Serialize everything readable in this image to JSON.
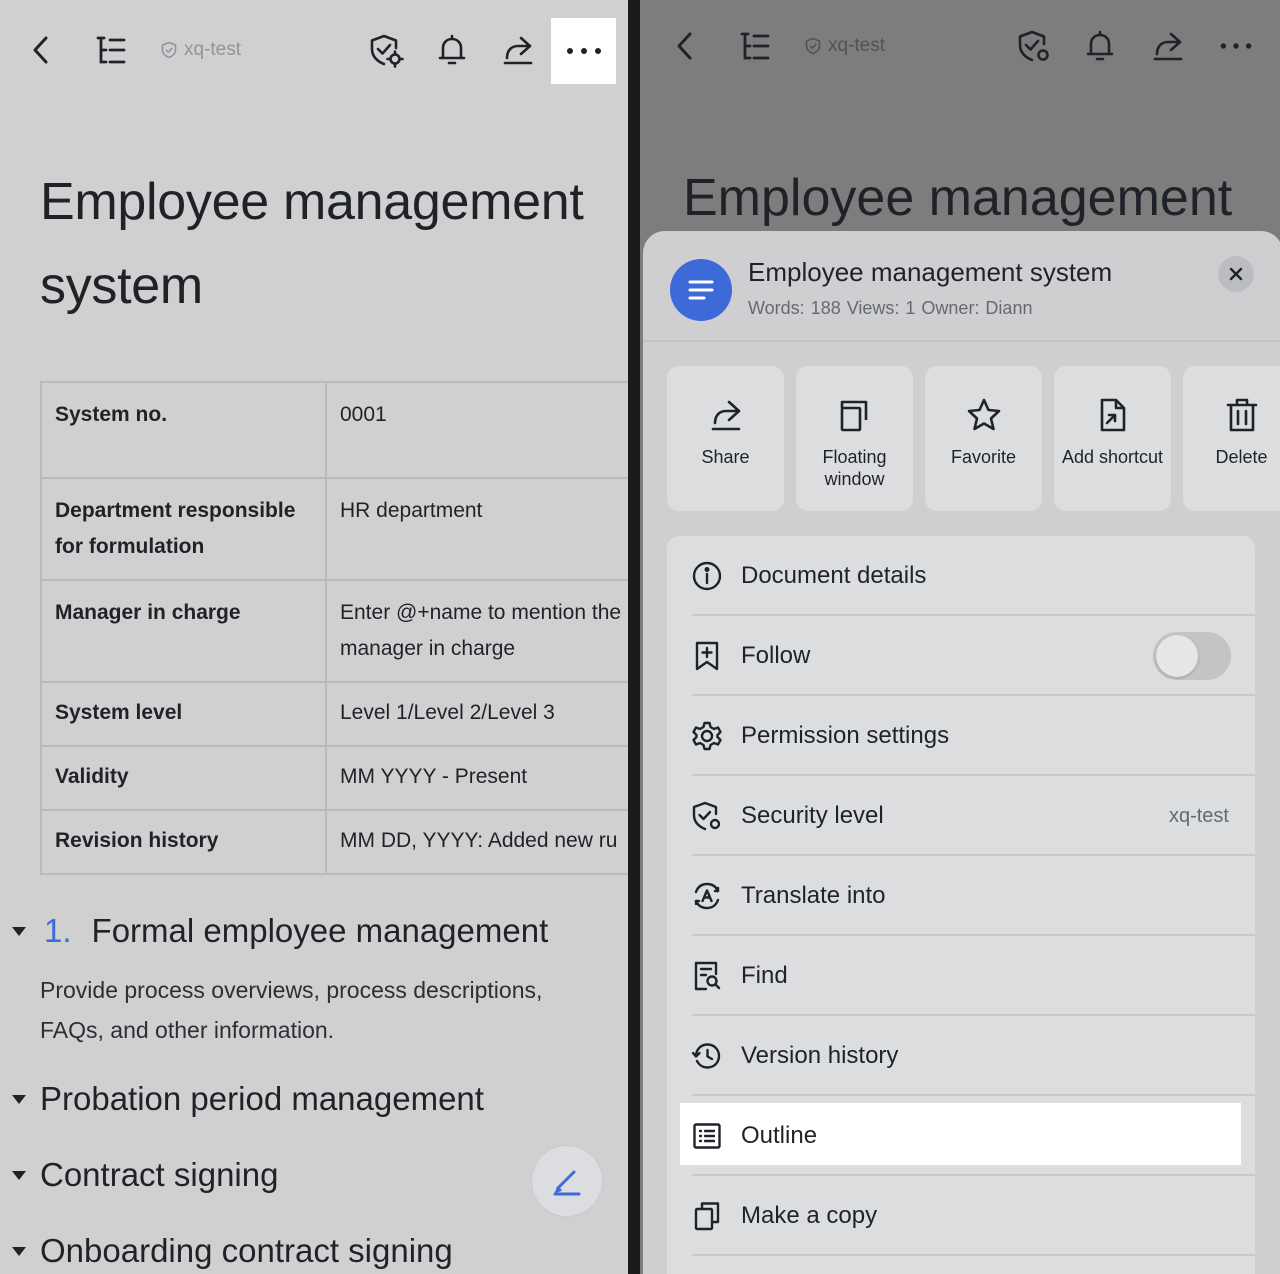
{
  "left": {
    "topbar": {
      "security_tag": "xq-test"
    },
    "doc_title": "Employee management system",
    "meta_table": [
      {
        "key": "System no.",
        "value": "0001"
      },
      {
        "key": "Department responsible for formulation",
        "value": "HR department"
      },
      {
        "key": "Manager in charge",
        "value": "Enter @+name to mention the manager in charge"
      },
      {
        "key": "System level",
        "value": "Level 1/Level 2/Level 3"
      },
      {
        "key": "Validity",
        "value": "MM YYYY - Present"
      },
      {
        "key": "Revision history",
        "value": "MM DD, YYYY: Added new ru"
      }
    ],
    "section1": {
      "number": "1.",
      "title": "Formal employee management",
      "body": "Provide process overviews, process descriptions, FAQs, and other information."
    },
    "headings": [
      "Probation period management",
      "Contract signing",
      "Onboarding contract signing"
    ]
  },
  "right": {
    "topbar": {
      "security_tag": "xq-test"
    },
    "bg_title": "Employee management",
    "sheet": {
      "title": "Employee management system",
      "meta": "Words: 188  Views: 1  Owner: Diann",
      "actions": [
        {
          "label": "Share",
          "icon": "share-icon"
        },
        {
          "label": "Floating window",
          "icon": "floating-window-icon"
        },
        {
          "label": "Favorite",
          "icon": "star-icon"
        },
        {
          "label": "Add shortcut",
          "icon": "shortcut-icon"
        },
        {
          "label": "Delete",
          "icon": "trash-icon"
        }
      ],
      "menu": [
        {
          "label": "Document details",
          "icon": "info-icon"
        },
        {
          "label": "Follow",
          "icon": "bookmark-plus-icon",
          "toggle": false
        },
        {
          "label": "Permission settings",
          "icon": "gear-icon"
        },
        {
          "label": "Security level",
          "icon": "shield-gear-icon",
          "value": "xq-test"
        },
        {
          "label": "Translate into",
          "icon": "translate-icon"
        },
        {
          "label": "Find",
          "icon": "find-icon"
        },
        {
          "label": "Version history",
          "icon": "history-icon"
        },
        {
          "label": "Outline",
          "icon": "outline-icon"
        },
        {
          "label": "Make a copy",
          "icon": "copy-icon"
        }
      ]
    }
  },
  "colors": {
    "accent": "#3c6ad8",
    "highlight": "#ffffff"
  }
}
